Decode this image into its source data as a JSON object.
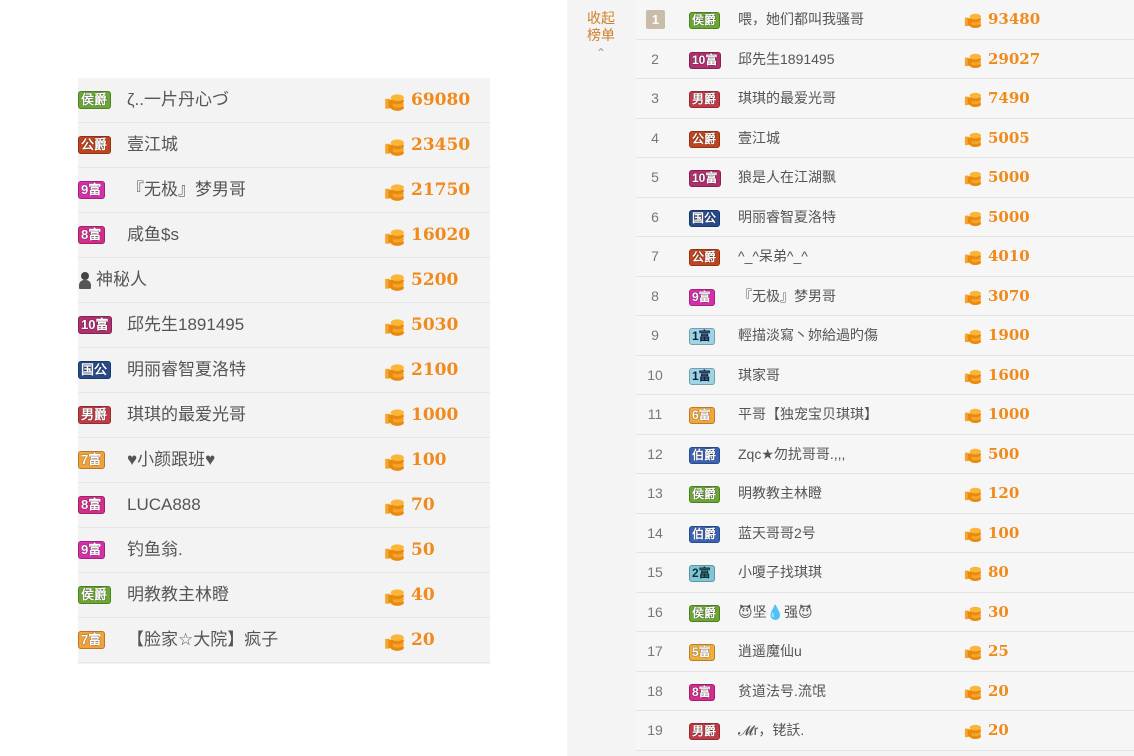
{
  "left": {
    "rows": [
      {
        "badge": "侯爵",
        "badge_type": "hou",
        "name": "ζ..一片丹心づ",
        "score": "69080"
      },
      {
        "badge": "公爵",
        "badge_type": "gong",
        "name": "壹江城",
        "score": "23450"
      },
      {
        "badge": "9富",
        "badge_type": "fu9",
        "name": "『无极』梦男哥",
        "score": "21750"
      },
      {
        "badge": "8富",
        "badge_type": "fu8",
        "name": "咸鱼$s",
        "score": "16020"
      },
      {
        "badge": "",
        "badge_type": "mys",
        "name": "神秘人",
        "score": "5200"
      },
      {
        "badge": "10富",
        "badge_type": "fu10",
        "name": "邱先生1891495",
        "score": "5030"
      },
      {
        "badge": "国公",
        "badge_type": "guo",
        "name": "明丽睿智夏洛特",
        "score": "2100"
      },
      {
        "badge": "男爵",
        "badge_type": "nan",
        "name": "琪琪的最爱光哥",
        "score": "1000"
      },
      {
        "badge": "7富",
        "badge_type": "fu7",
        "name": "♥小颜跟班♥",
        "score": "100"
      },
      {
        "badge": "8富",
        "badge_type": "fu8",
        "name": "LUCA888",
        "score": "70"
      },
      {
        "badge": "9富",
        "badge_type": "fu9",
        "name": "钓鱼翁.",
        "score": "50"
      },
      {
        "badge": "侯爵",
        "badge_type": "hou",
        "name": "明教教主林瞪",
        "score": "40"
      },
      {
        "badge": "7富",
        "badge_type": "fu7",
        "name": "【脸家☆大院】疯子",
        "score": "20"
      }
    ]
  },
  "right": {
    "collapse_label_1": "收起",
    "collapse_label_2": "榜单",
    "collapse_icon": "chevron-up-icon",
    "rows": [
      {
        "rank": "1",
        "badge": "侯爵",
        "badge_type": "hou",
        "name": "喂，她们都叫我骚哥",
        "score": "93480"
      },
      {
        "rank": "2",
        "badge": "10富",
        "badge_type": "fu10",
        "name": "邱先生1891495",
        "score": "29027"
      },
      {
        "rank": "3",
        "badge": "男爵",
        "badge_type": "nan",
        "name": "琪琪的最爱光哥",
        "score": "7490"
      },
      {
        "rank": "4",
        "badge": "公爵",
        "badge_type": "gong",
        "name": "壹江城",
        "score": "5005"
      },
      {
        "rank": "5",
        "badge": "10富",
        "badge_type": "fu10",
        "name": "狼是人在江湖飘",
        "score": "5000"
      },
      {
        "rank": "6",
        "badge": "国公",
        "badge_type": "guo",
        "name": "明丽睿智夏洛特",
        "score": "5000"
      },
      {
        "rank": "7",
        "badge": "公爵",
        "badge_type": "gong",
        "name": "^_^呆弟^_^",
        "score": "4010"
      },
      {
        "rank": "8",
        "badge": "9富",
        "badge_type": "fu9",
        "name": "『无极』梦男哥",
        "score": "3070"
      },
      {
        "rank": "9",
        "badge": "1富",
        "badge_type": "fu1",
        "name": "輕描淡寫丶妳給過旳傷",
        "score": "1900"
      },
      {
        "rank": "10",
        "badge": "1富",
        "badge_type": "fu1",
        "name": "琪家哥",
        "score": "1600"
      },
      {
        "rank": "11",
        "badge": "6富",
        "badge_type": "fu6",
        "name": "平哥【独宠宝贝琪琪】",
        "score": "1000"
      },
      {
        "rank": "12",
        "badge": "伯爵",
        "badge_type": "bo",
        "name": "Zqc★勿扰哥哥.,,,",
        "score": "500"
      },
      {
        "rank": "13",
        "badge": "侯爵",
        "badge_type": "hou",
        "name": "明教教主林瞪",
        "score": "120"
      },
      {
        "rank": "14",
        "badge": "伯爵",
        "badge_type": "bo",
        "name": "蓝天哥哥2号",
        "score": "100"
      },
      {
        "rank": "15",
        "badge": "2富",
        "badge_type": "fu2",
        "name": "小嗄子找琪琪",
        "score": "80"
      },
      {
        "rank": "16",
        "badge": "侯爵",
        "badge_type": "hou",
        "name": "😈坚💧强😈",
        "score": "30"
      },
      {
        "rank": "17",
        "badge": "5富",
        "badge_type": "fu5",
        "name": "逍遥魔仙u",
        "score": "25"
      },
      {
        "rank": "18",
        "badge": "8富",
        "badge_type": "fu8",
        "name": "贫道法号.流氓",
        "score": "20"
      },
      {
        "rank": "19",
        "badge": "男爵",
        "badge_type": "nan",
        "name": "𝓜r，铑訞.",
        "score": "20"
      }
    ]
  },
  "colors": {
    "score": "#f08a1a",
    "collapse": "#d0802c",
    "name": "#555555",
    "rank_top_bg": "#c9bca8"
  }
}
